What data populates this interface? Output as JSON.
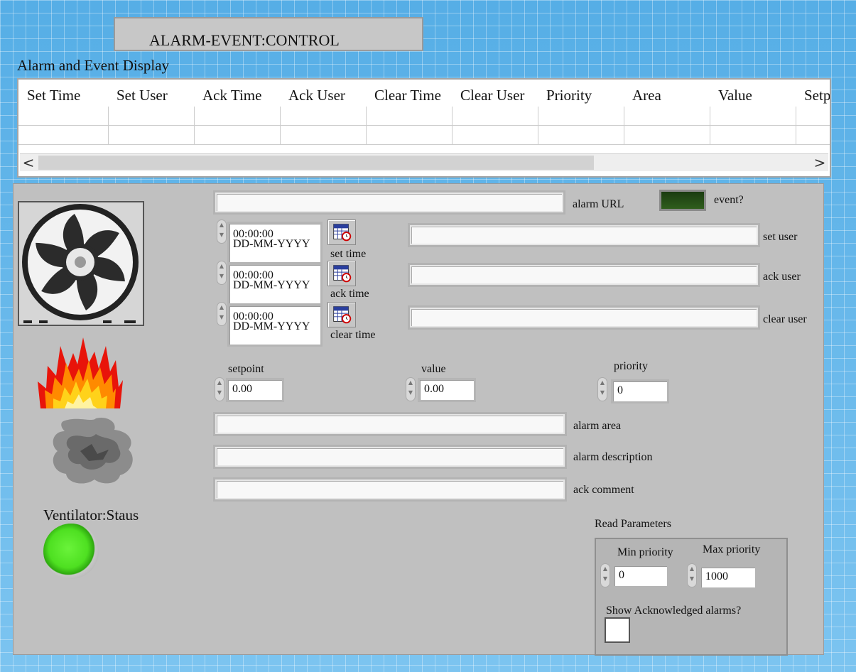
{
  "title_button": "ALARM-EVENT:CONTROL",
  "display": {
    "label": "Alarm and Event Display",
    "columns": [
      "Set Time",
      "Set User",
      "Ack Time",
      "Ack User",
      "Clear Time",
      "Clear User",
      "Priority",
      "Area",
      "Value",
      "Setp"
    ],
    "scroll_left": "<",
    "scroll_right": ">"
  },
  "fields": {
    "alarm_url": "alarm URL",
    "event": "event?",
    "set_user": "set user",
    "ack_user": "ack user",
    "clear_user": "clear user",
    "set_time": "set time",
    "ack_time": "ack time",
    "clear_time": "clear time",
    "time_value": "00:00:00",
    "date_value": "DD-MM-YYYY",
    "setpoint_label": "setpoint",
    "setpoint_value": "0.00",
    "value_label": "value",
    "value_value": "0.00",
    "priority_label": "priority",
    "priority_value": "0",
    "alarm_area": "alarm area",
    "alarm_description": "alarm description",
    "ack_comment": "ack comment"
  },
  "status": {
    "ventilator_label": "Ventilator:Staus",
    "led_color": "#4ee021",
    "icons": [
      "fan-icon",
      "fire-icon",
      "smoke-icon"
    ]
  },
  "read_params": {
    "label": "Read Parameters",
    "min_label": "Min priority",
    "min_value": "0",
    "max_label": "Max priority",
    "max_value": "1000",
    "show_ack_label": "Show Acknowledged alarms?"
  }
}
